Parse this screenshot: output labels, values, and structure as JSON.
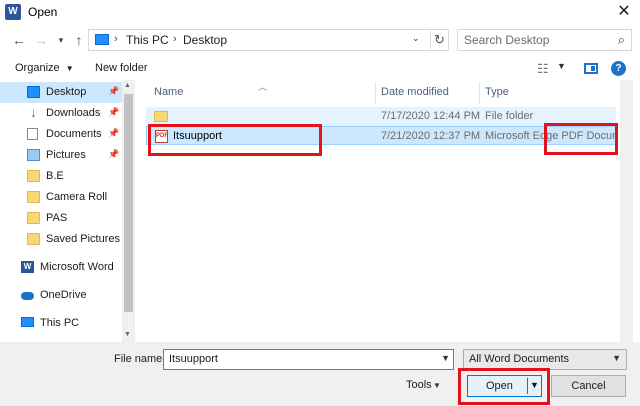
{
  "window": {
    "title": "Open",
    "app_icon": "word-icon"
  },
  "nav": {
    "back_icon": "back-arrow-icon",
    "forward_icon": "forward-arrow-icon",
    "recent_icon": "chevron-down-icon",
    "up_icon": "up-arrow-icon",
    "breadcrumb": [
      "This PC",
      "Desktop"
    ],
    "search_placeholder": "Search Desktop"
  },
  "toolbar": {
    "organize_label": "Organize",
    "new_folder_label": "New folder"
  },
  "sidebar": {
    "items": [
      {
        "label": "Desktop",
        "icon": "desktop-icon",
        "pinned": true,
        "selected": true
      },
      {
        "label": "Downloads",
        "icon": "download-icon",
        "pinned": true
      },
      {
        "label": "Documents",
        "icon": "documents-icon",
        "pinned": true
      },
      {
        "label": "Pictures",
        "icon": "pictures-icon",
        "pinned": true
      },
      {
        "label": "B.E",
        "icon": "folder-icon"
      },
      {
        "label": "Camera Roll",
        "icon": "folder-icon"
      },
      {
        "label": "PAS",
        "icon": "folder-icon"
      },
      {
        "label": "Saved Pictures",
        "icon": "folder-icon"
      },
      {
        "label": "Microsoft Word",
        "icon": "word-icon"
      },
      {
        "label": "OneDrive",
        "icon": "cloud-icon"
      },
      {
        "label": "This PC",
        "icon": "pc-icon"
      }
    ]
  },
  "columns": {
    "name": "Name",
    "date": "Date modified",
    "type": "Type"
  },
  "files": [
    {
      "name": "",
      "date": "7/17/2020 12:44 PM",
      "type": "File folder",
      "icon": "folder-icon"
    },
    {
      "name": "Itsuupport",
      "date": "7/21/2020 12:37 PM",
      "type": "Microsoft Edge PDF Docum...",
      "icon": "pdf-icon"
    }
  ],
  "bottom": {
    "file_name_label": "File name:",
    "file_name_value": "Itsuupport",
    "filter_value": "All Word Documents",
    "tools_label": "Tools",
    "open_label": "Open",
    "cancel_label": "Cancel"
  },
  "colors": {
    "accent": "#0078d7",
    "selection": "#cce8ff",
    "annotation": "#e3121c"
  }
}
